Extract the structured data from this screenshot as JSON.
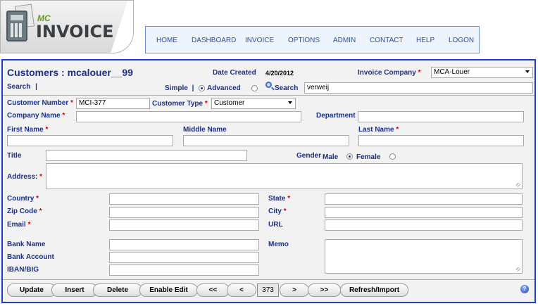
{
  "logo": {
    "mc": "MC",
    "invoice": "INVOICE"
  },
  "nav": [
    "HOME",
    "DASHBOARD",
    "INVOICE",
    "OPTIONS",
    "ADMIN",
    "CONTACT",
    "HELP",
    "LOGON"
  ],
  "form": {
    "title": "Customers : mcalouer__99",
    "date_created_label": "Date Created",
    "date_created_value": "4/20/2012",
    "invoice_company_label": "Invoice Company",
    "invoice_company_value": "MCA-Louer",
    "search_label": "Search",
    "simple_label": "Simple",
    "advanced_label": "Advanced",
    "search_button": "Search",
    "search_value": "verweij",
    "customer_number_label": "Customer Number",
    "customer_number_value": "MCI-377",
    "customer_type_label": "Customer Type",
    "customer_type_value": "Customer",
    "company_name_label": "Company Name",
    "department_label": "Department",
    "first_name_label": "First Name",
    "middle_name_label": "Middle Name",
    "last_name_label": "Last Name",
    "title_label": "Title",
    "gender_label": "Gender",
    "male_label": "Male",
    "female_label": "Female",
    "address_label": "Address:",
    "country_label": "Country",
    "state_label": "State",
    "zip_label": "Zip Code",
    "city_label": "City",
    "email_label": "Email",
    "url_label": "URL",
    "bank_name_label": "Bank Name",
    "memo_label": "Memo",
    "bank_account_label": "Bank Account",
    "iban_label": "IBAN/BIG",
    "required_mark": "*"
  },
  "toolbar": {
    "update": "Update",
    "insert": "Insert",
    "delete": "Delete",
    "enable_edit": "Enable Edit",
    "first": "<<",
    "prev": "<",
    "page": "373",
    "next": ">",
    "last": ">>",
    "refresh_import": "Refresh/Import",
    "help_icon": "?"
  },
  "colors": {
    "accent": "#1a2f8f",
    "border": "#1b3fcf",
    "required": "#d40000"
  }
}
